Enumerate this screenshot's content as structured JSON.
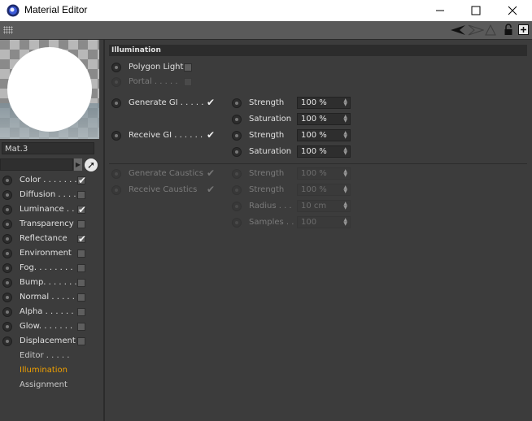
{
  "window": {
    "title": "Material Editor",
    "minimize": "—",
    "maximize": "☐",
    "close": "✕"
  },
  "material": {
    "name": "Mat.3"
  },
  "channels": [
    {
      "label": "Color . . . . . . .",
      "checked": "✔"
    },
    {
      "label": "Diffusion . . . .",
      "checked": ""
    },
    {
      "label": "Luminance . . .",
      "checked": "✔"
    },
    {
      "label": "Transparency",
      "checked": ""
    },
    {
      "label": "Reflectance",
      "checked": "✔"
    },
    {
      "label": "Environment",
      "checked": ""
    },
    {
      "label": "Fog. . . . . . . .",
      "checked": ""
    },
    {
      "label": "Bump. . . . . . .",
      "checked": ""
    },
    {
      "label": "Normal . . . . .",
      "checked": ""
    },
    {
      "label": "Alpha . . . . . .",
      "checked": ""
    },
    {
      "label": "Glow. . . . . . .",
      "checked": ""
    },
    {
      "label": "Displacement",
      "checked": ""
    }
  ],
  "extra_items": [
    {
      "label": "Editor  . . . . .",
      "color": "#d8d8d8"
    },
    {
      "label": "Illumination",
      "color": "#f0a000"
    },
    {
      "label": "Assignment",
      "color": "#d8d8d8"
    }
  ],
  "illumination": {
    "header": "Illumination",
    "polygon_light": "Polygon Light",
    "portal": "Portal . . . . .",
    "generate_gi": "Generate GI  . . . . .",
    "generate_gi_check": "✔",
    "receive_gi": "Receive GI . . . . . .",
    "receive_gi_check": "✔",
    "strength_label": "Strength",
    "saturation_label": "Saturation",
    "gen_strength": "100 %",
    "gen_saturation": "100 %",
    "rec_strength": "100 %",
    "rec_saturation": "100 %",
    "generate_caustics": "Generate Caustics",
    "generate_caustics_check": "✔",
    "receive_caustics": "Receive Caustics",
    "receive_caustics_check": "✔",
    "caustic_strength_1": "100 %",
    "caustic_strength_2": "100 %",
    "radius_label": "Radius . . .",
    "radius_value": "10 cm",
    "samples_label": "Samples . .",
    "samples_value": "100"
  }
}
